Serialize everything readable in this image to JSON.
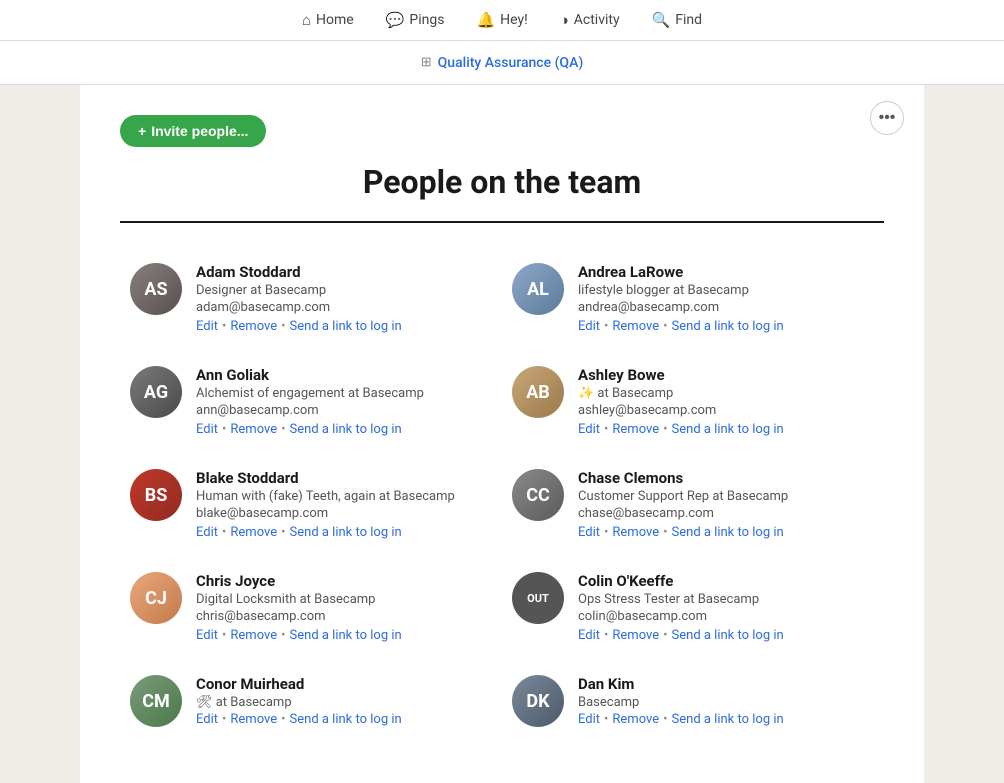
{
  "nav": {
    "items": [
      {
        "label": "Home",
        "icon": "⌂",
        "name": "home"
      },
      {
        "label": "Pings",
        "icon": "💬",
        "name": "pings"
      },
      {
        "label": "Hey!",
        "icon": "🔔",
        "name": "hey"
      },
      {
        "label": "Activity",
        "icon": "◑",
        "name": "activity"
      },
      {
        "label": "Find",
        "icon": "🔍",
        "name": "find"
      }
    ]
  },
  "breadcrumb": {
    "icon": "⊞",
    "label": "Quality Assurance (QA)",
    "link": "#"
  },
  "page": {
    "title": "People on the team",
    "invite_button": "+ Invite people...",
    "more_button": "•••"
  },
  "people": [
    {
      "id": "adam-stoddard",
      "name": "Adam Stoddard",
      "role": "Designer at Basecamp",
      "email": "adam@basecamp.com",
      "initials": "AS",
      "avatar_class": "avatar-as",
      "out": false,
      "badge": null,
      "actions": [
        "Edit",
        "Remove",
        "Send a link to log in"
      ]
    },
    {
      "id": "andrea-larowe",
      "name": "Andrea LaRowe",
      "role": "lifestyle blogger at Basecamp",
      "email": "andrea@basecamp.com",
      "initials": "AL",
      "avatar_class": "avatar-al",
      "out": false,
      "badge": null,
      "actions": [
        "Edit",
        "Remove",
        "Send a link to log in"
      ]
    },
    {
      "id": "ann-goliak",
      "name": "Ann Goliak",
      "role": "Alchemist of engagement at Basecamp",
      "email": "ann@basecamp.com",
      "initials": "AG",
      "avatar_class": "avatar-ag",
      "out": false,
      "badge": null,
      "actions": [
        "Edit",
        "Remove",
        "Send a link to log in"
      ]
    },
    {
      "id": "ashley-bowe",
      "name": "Ashley Bowe",
      "role": "✨ at Basecamp",
      "email": "ashley@basecamp.com",
      "initials": "AB",
      "avatar_class": "avatar-ab",
      "out": false,
      "badge": null,
      "actions": [
        "Edit",
        "Remove",
        "Send a link to log in"
      ]
    },
    {
      "id": "blake-stoddard",
      "name": "Blake Stoddard",
      "role": "Human with (fake) Teeth, again at Basecamp",
      "email": "blake@basecamp.com",
      "initials": "BS",
      "avatar_class": "avatar-bs",
      "out": false,
      "badge": null,
      "actions": [
        "Edit",
        "Remove",
        "Send a link to log in"
      ]
    },
    {
      "id": "chase-clemons",
      "name": "Chase Clemons",
      "role": "Customer Support Rep at Basecamp",
      "email": "chase@basecamp.com",
      "initials": "CC",
      "avatar_class": "avatar-cc",
      "out": false,
      "badge": null,
      "actions": [
        "Edit",
        "Remove",
        "Send a link to log in"
      ]
    },
    {
      "id": "chris-joyce",
      "name": "Chris Joyce",
      "role": "Digital Locksmith at Basecamp",
      "email": "chris@basecamp.com",
      "initials": "CJ",
      "avatar_class": "avatar-cj",
      "out": false,
      "badge": null,
      "actions": [
        "Edit",
        "Remove",
        "Send a link to log in"
      ]
    },
    {
      "id": "colin-okeeffe",
      "name": "Colin O'Keeffe",
      "role": "Ops Stress Tester at Basecamp",
      "email": "colin@basecamp.com",
      "initials": "OUT",
      "avatar_class": "avatar-co",
      "out": true,
      "badge": "OUT",
      "actions": [
        "Edit",
        "Remove",
        "Send a link to log in"
      ]
    },
    {
      "id": "conor-muirhead",
      "name": "Conor Muirhead",
      "role": "🛠 at Basecamp",
      "email": "",
      "initials": "CM",
      "avatar_class": "avatar-cm",
      "out": false,
      "badge": null,
      "actions": [
        "Edit",
        "Remove",
        "Send a link to log in"
      ]
    },
    {
      "id": "dan-kim",
      "name": "Dan Kim",
      "role": "Basecamp",
      "email": "",
      "initials": "DK",
      "avatar_class": "avatar-dk",
      "out": false,
      "badge": null,
      "actions": [
        "Edit",
        "Remove",
        "Send a link to log in"
      ]
    }
  ],
  "actions": {
    "edit": "Edit",
    "remove": "Remove",
    "send_link": "Send a link to log in",
    "sep": "•"
  }
}
